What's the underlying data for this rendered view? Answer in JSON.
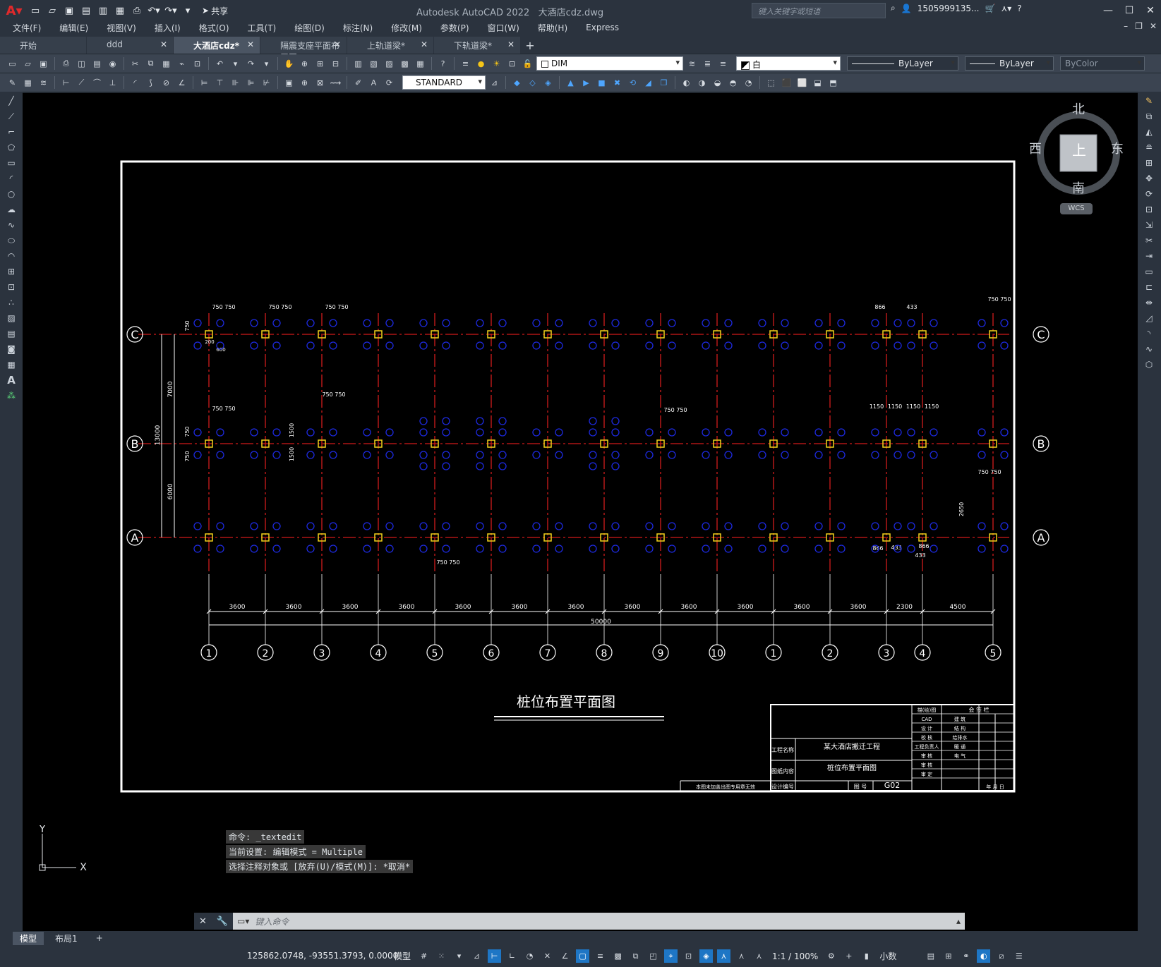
{
  "window": {
    "app_title": "Autodesk AutoCAD 2022",
    "file_title": "大酒店cdz.dwg",
    "search_placeholder": "键入关键字或短语",
    "user": "1505999135...",
    "share_label": "共享",
    "help": "?"
  },
  "menu": {
    "items": [
      "文件(F)",
      "编辑(E)",
      "视图(V)",
      "插入(I)",
      "格式(O)",
      "工具(T)",
      "绘图(D)",
      "标注(N)",
      "修改(M)",
      "参数(P)",
      "窗口(W)",
      "帮助(H)",
      "Express"
    ]
  },
  "tabs": [
    {
      "label": "开始",
      "active": false,
      "closable": false
    },
    {
      "label": "ddd",
      "active": false,
      "closable": true
    },
    {
      "label": "大酒店cdz*",
      "active": true,
      "closable": true
    },
    {
      "label": "隔震支座平面布置图*",
      "active": false,
      "closable": true
    },
    {
      "label": "上轨道梁*",
      "active": false,
      "closable": true
    },
    {
      "label": "下轨道梁*",
      "active": false,
      "closable": true
    }
  ],
  "properties": {
    "layer": "DIM",
    "color": "白",
    "linetype": "ByLayer",
    "lineweight": "ByLayer",
    "plotstyle": "ByColor",
    "text_style": "STANDARD"
  },
  "viewcube": {
    "north": "北",
    "south": "南",
    "east": "东",
    "west": "西",
    "face": "上",
    "wcs": "WCS"
  },
  "drawing": {
    "title": "桩位布置平面图",
    "row_axes": [
      "C",
      "B",
      "A"
    ],
    "col_axes": [
      "1",
      "2",
      "3",
      "4",
      "5",
      "6",
      "7",
      "8",
      "9",
      "10",
      "1",
      "2",
      "3",
      "4",
      "5"
    ],
    "col_spacings": [
      "3600",
      "3600",
      "3600",
      "3600",
      "3600",
      "3600",
      "3600",
      "3600",
      "3600",
      "3600",
      "3600",
      "3600",
      "2300",
      "4500"
    ],
    "total_length": "50000",
    "left_dims": [
      "7000",
      "6000",
      "13000",
      "750",
      "750",
      "750"
    ],
    "dim_labels": [
      "750 750",
      "1150",
      "866",
      "433",
      "1500",
      "2650",
      "200",
      "600"
    ],
    "title_block": {
      "project_label": "工程名称",
      "project": "某大酒店搬迁工程",
      "content_label": "图纸内容",
      "content": "桩位布置平面图",
      "design_no": "设计编号",
      "drawing_no_label": "图 号",
      "drawing_no": "G02",
      "note": "本图未加盖出图专用章无效",
      "roles": [
        "描(绘)图",
        "CAD",
        "设 计",
        "校 核",
        "工程负责人",
        "审 核",
        "审 核",
        "审 定"
      ],
      "cosign_header": "会 签 栏",
      "disciplines": [
        "建 筑",
        "结 构",
        "给排水",
        "暖 通",
        "电 气"
      ],
      "date": "年 月 日"
    }
  },
  "command": {
    "history": [
      "命令: _textedit",
      "当前设置: 编辑模式 = Multiple",
      "选择注释对象或 [放弃(U)/模式(M)]: *取消*"
    ],
    "placeholder": "键入命令"
  },
  "layout_tabs": [
    "模型",
    "布局1"
  ],
  "status": {
    "coords": "125862.0748, -93551.3793, 0.0000",
    "model": "模型",
    "scale": "1:1 / 100%",
    "units": "小数"
  }
}
